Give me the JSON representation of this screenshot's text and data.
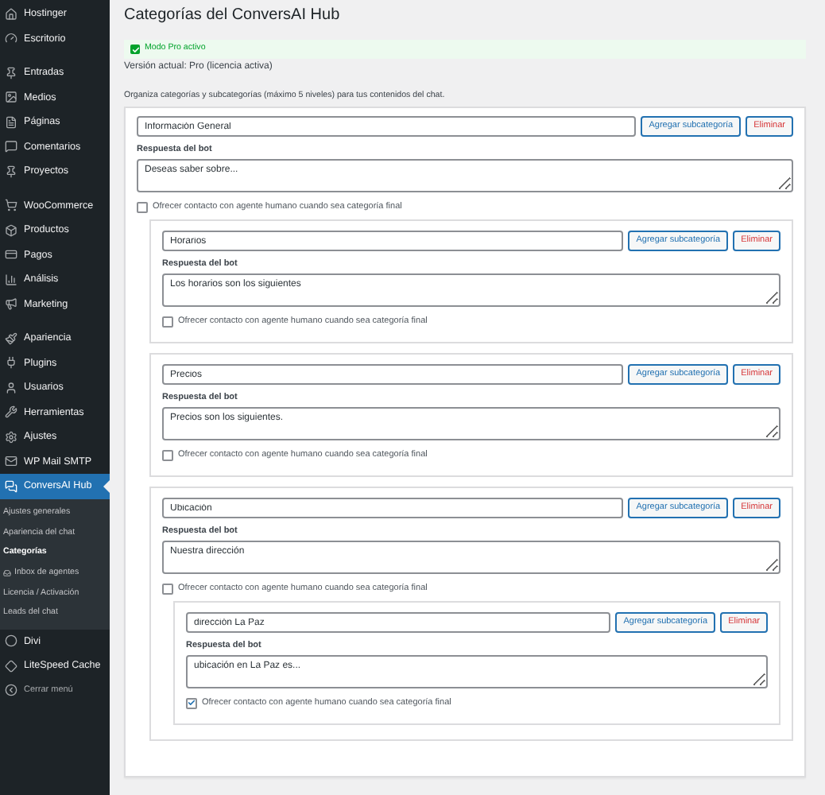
{
  "sidebar": {
    "groups": [
      [
        {
          "label": "Hostinger",
          "selected": false
        },
        {
          "label": "Escritorio",
          "selected": false
        }
      ],
      [
        {
          "label": "Entradas",
          "selected": false
        },
        {
          "label": "Medios",
          "selected": false
        },
        {
          "label": "Páginas",
          "selected": false
        },
        {
          "label": "Comentarios",
          "selected": false
        },
        {
          "label": "Proyectos",
          "selected": false
        }
      ],
      [
        {
          "label": "WooCommerce",
          "selected": false
        },
        {
          "label": "Productos",
          "selected": false
        },
        {
          "label": "Pagos",
          "selected": false
        },
        {
          "label": "Análisis",
          "selected": false
        },
        {
          "label": "Marketing",
          "selected": false
        }
      ],
      [
        {
          "label": "Apariencia",
          "selected": false
        },
        {
          "label": "Plugins",
          "selected": false
        },
        {
          "label": "Usuarios",
          "selected": false
        },
        {
          "label": "Herramientas",
          "selected": false
        },
        {
          "label": "Ajustes",
          "selected": false
        },
        {
          "label": "WP Mail SMTP",
          "selected": false
        },
        {
          "label": "ConversAI Hub",
          "selected": true,
          "submenu": [
            {
              "label": "Ajustes generales",
              "selected": false
            },
            {
              "label": "Apariencia del chat",
              "selected": false
            },
            {
              "label": "Categorías",
              "selected": true
            },
            {
              "label": "Inbox de agentes",
              "selected": false,
              "icon": true
            },
            {
              "label": "Licencia / Activación",
              "selected": false
            },
            {
              "label": "Leads del chat",
              "selected": false
            }
          ]
        },
        {
          "label": "Divi",
          "selected": false
        },
        {
          "label": "LiteSpeed Cache",
          "selected": false
        }
      ]
    ],
    "collapse": "Cerrar menú"
  },
  "page": {
    "title": "Categorías del ConversAI Hub",
    "notice": "Modo Pro activo",
    "version": "Versión actual: Pro (licencia activa)",
    "intro": "Organiza categorías y subcategorías (máximo 5 niveles) para tus contenidos del chat."
  },
  "categories": [
    {
      "name": "Información General",
      "add_button": "Agregar subcategoría",
      "delete_button": "Eliminar",
      "response_label": "Respuesta del bot",
      "response": "Deseas saber sobre...",
      "agent_label": "Ofrecer contacto con agente humano cuando sea categoría final",
      "checked": false,
      "children": [
        {
          "name": "Horarios",
          "add_button": "Agregar subcategoría",
          "delete_button": "Eliminar",
          "response_label": "Respuesta del bot",
          "response": "Los horarios son los siguientes",
          "agent_label": "Ofrecer contacto con agente humano cuando sea categoría final",
          "checked": false
        },
        {
          "name": "Precios",
          "add_button": "Agregar subcategoría",
          "delete_button": "Eliminar",
          "response_label": "Respuesta del bot",
          "response": "Precios son los siguientes.",
          "agent_label": "Ofrecer contacto con agente humano cuando sea categoría final",
          "checked": false
        },
        {
          "name": "Ubicación",
          "add_button": "Agregar subcategoría",
          "delete_button": "Eliminar",
          "response_label": "Respuesta del bot",
          "response": "Nuestra dirección",
          "agent_label": "Ofrecer contacto con agente humano cuando sea categoría final",
          "checked": false,
          "children": [
            {
              "name": "dirección La Paz",
              "add_button": "Agregar subcategoría",
              "delete_button": "Eliminar",
              "response_label": "Respuesta del bot",
              "response": "ubicación en La Paz es...",
              "agent_label": "Ofrecer contacto con agente humano cuando sea categoría final",
              "checked": true
            }
          ]
        }
      ]
    }
  ]
}
